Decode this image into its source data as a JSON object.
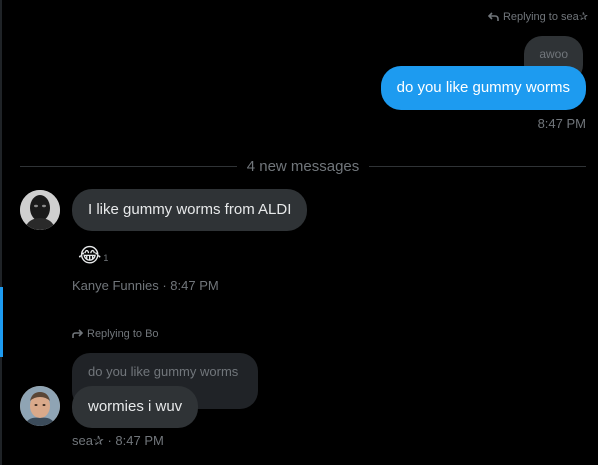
{
  "top_reply": {
    "label": "Replying to sea✰",
    "icon": "reply-arrow-icon"
  },
  "outgoing": {
    "quoted_text": "awoo",
    "message": "do you like gummy worms",
    "time": "8:47 PM",
    "bubble_color": "#1d9bf0"
  },
  "divider": {
    "label": "4 new messages"
  },
  "incoming_1": {
    "message": "I like gummy worms from ALDI",
    "reaction": {
      "emoji": "😂",
      "count": "1"
    },
    "meta": "Kanye Funnies · 8:47 PM"
  },
  "incoming_2": {
    "reply_label": "Replying to Bo",
    "quoted_text": "do you like gummy worms",
    "message": "wormies i wuv",
    "meta": "sea✰ · 8:47 PM"
  },
  "colors": {
    "background": "#000000",
    "bubble_gray": "#2f3336",
    "muted_text": "#71767b",
    "accent": "#1d9bf0"
  }
}
